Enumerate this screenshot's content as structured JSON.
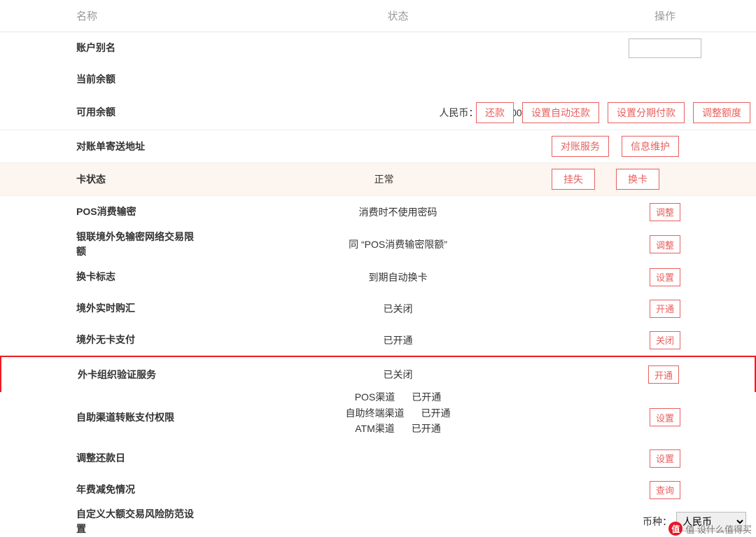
{
  "header": {
    "name": "名称",
    "status": "状态",
    "action": "操作"
  },
  "rows": {
    "alias": {
      "label": "账户别名"
    },
    "current_balance": {
      "label": "当前余额"
    },
    "available_balance": {
      "label": "可用余额",
      "status": "人民币：66,670.00",
      "buttons": [
        "还款",
        "设置自动还款",
        "设置分期付款",
        "调整额度"
      ]
    },
    "statement_addr": {
      "label": "对账单寄送地址",
      "buttons": [
        "对账服务",
        "信息维护"
      ]
    },
    "card_status": {
      "label": "卡状态",
      "status": "正常",
      "buttons": [
        "挂失",
        "换卡"
      ]
    },
    "pos_pin": {
      "label": "POS消费输密",
      "status": "消费时不使用密码",
      "button": "调整"
    },
    "unionpay_limit": {
      "label": "银联境外免输密网络交易限额",
      "status": "同 “POS消费输密限额”",
      "button": "调整"
    },
    "card_replace": {
      "label": "换卡标志",
      "status": "到期自动换卡",
      "button": "设置"
    },
    "fx_realtime": {
      "label": "境外实时购汇",
      "status": "已关闭",
      "button": "开通"
    },
    "cardless_abroad": {
      "label": "境外无卡支付",
      "status": "已开通",
      "button": "关闭"
    },
    "foreign_verify": {
      "label": "外卡组织验证服务",
      "status": "已关闭",
      "button": "开通"
    },
    "self_channel": {
      "label": "自助渠道转账支付权限",
      "lines": [
        {
          "k": "POS渠道",
          "v": "已开通"
        },
        {
          "k": "自助终端渠道",
          "v": "已开通"
        },
        {
          "k": "ATM渠道",
          "v": "已开通"
        }
      ],
      "button": "设置"
    },
    "repay_day": {
      "label": "调整还款日",
      "button": "设置"
    },
    "annual_fee": {
      "label": "年费减免情况",
      "button": "查询"
    },
    "custom_risk": {
      "label": "自定义大额交易风险防范设置",
      "currency_label": "币种：",
      "currency_value": "人民币"
    }
  },
  "watermark": "值 设什么值得买"
}
